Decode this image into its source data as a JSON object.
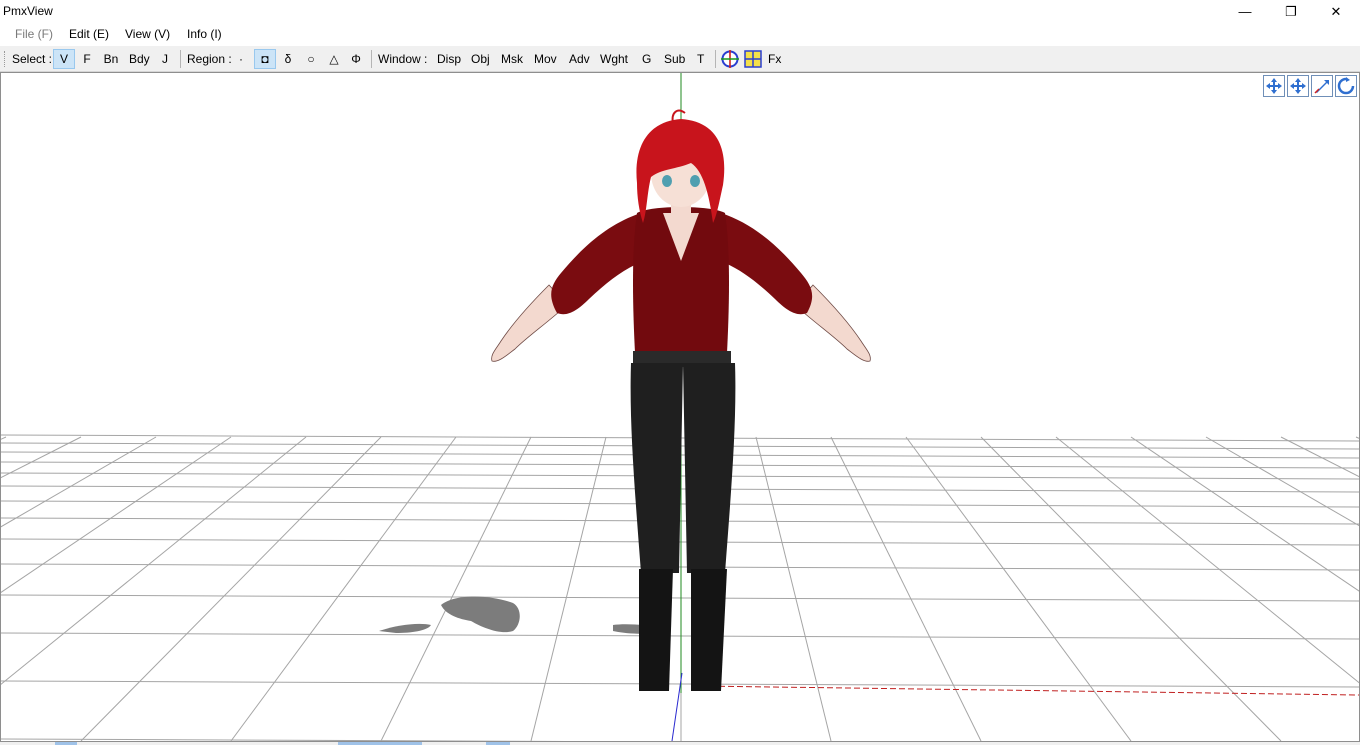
{
  "window": {
    "title": "PmxView"
  },
  "window_controls": {
    "minimize": "—",
    "restore": "❐",
    "close": "✕"
  },
  "menu": {
    "file": "File (F)",
    "edit": "Edit (E)",
    "view": "View (V)",
    "info": "Info (I)"
  },
  "toolbar": {
    "select_label": "Select :",
    "select_modes": [
      "V",
      "F",
      "Bn",
      "Bdy",
      "J"
    ],
    "selected_mode": "V",
    "region_label": "Region :",
    "region_modes": [
      "·",
      "◘",
      "δ",
      "○",
      "△",
      "Φ"
    ],
    "selected_region": "◘",
    "window_label": "Window :",
    "window_buttons": [
      "Disp",
      "Obj",
      "Msk",
      "Mov",
      "Adv",
      "Wght",
      "G",
      "Sub",
      "T"
    ],
    "fx_label": "Fx"
  },
  "icons": {
    "axis_toggle": "crosshair-circle-icon",
    "grid_toggle": "grid-icon",
    "camera_pan": "pan-cross-icon",
    "camera_move": "move-cross-icon",
    "camera_zoom": "zoom-arrow-icon",
    "camera_rotate": "rotate-arrow-icon"
  },
  "colors": {
    "axis_y": "#1f8a1f",
    "axis_z": "#2a2ad0",
    "axis_x": "#c02020",
    "grid": "#9a9a9a",
    "hair": "#c8141c",
    "shirt": "#7a0c10",
    "pants": "#1f1f1f",
    "skin": "#f3d9cf",
    "shadow": "#7c7c7c",
    "button_border": "#6f8fb8",
    "active_bg": "#cce4f7"
  }
}
